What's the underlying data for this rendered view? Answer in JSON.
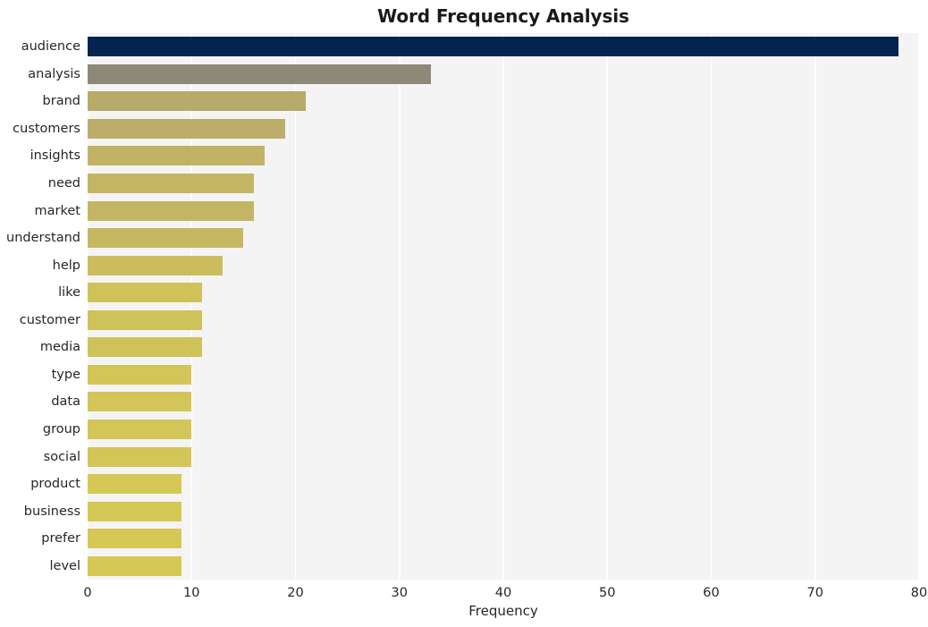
{
  "chart_data": {
    "type": "bar",
    "orientation": "horizontal",
    "title": "Word Frequency Analysis",
    "xlabel": "Frequency",
    "ylabel": "",
    "categories": [
      "audience",
      "analysis",
      "brand",
      "customers",
      "insights",
      "need",
      "market",
      "understand",
      "help",
      "like",
      "customer",
      "media",
      "type",
      "data",
      "group",
      "social",
      "product",
      "business",
      "prefer",
      "level"
    ],
    "values": [
      78,
      33,
      21,
      19,
      17,
      16,
      16,
      15,
      13,
      11,
      11,
      11,
      10,
      10,
      10,
      10,
      9,
      9,
      9,
      9
    ],
    "bar_colors": [
      "#04244f",
      "#8e8878",
      "#b8aa6b",
      "#bcae6a",
      "#c1b266",
      "#c4b564",
      "#c4b564",
      "#c6b762",
      "#cbbc5e",
      "#d0c25a",
      "#d0c25a",
      "#d0c25a",
      "#d3c557",
      "#d3c557",
      "#d3c557",
      "#d3c557",
      "#d6c855",
      "#d6c855",
      "#d6c855",
      "#d6c855"
    ],
    "xlim": [
      0,
      80
    ],
    "x_ticks": [
      0,
      10,
      20,
      30,
      40,
      50,
      60,
      70,
      80
    ],
    "x_tick_labels": [
      "0",
      "10",
      "20",
      "30",
      "40",
      "50",
      "60",
      "70",
      "80"
    ],
    "grid": "vertical-white",
    "plot_background": "#f4f4f5",
    "figure_background": "#ffffff",
    "legend": null
  }
}
